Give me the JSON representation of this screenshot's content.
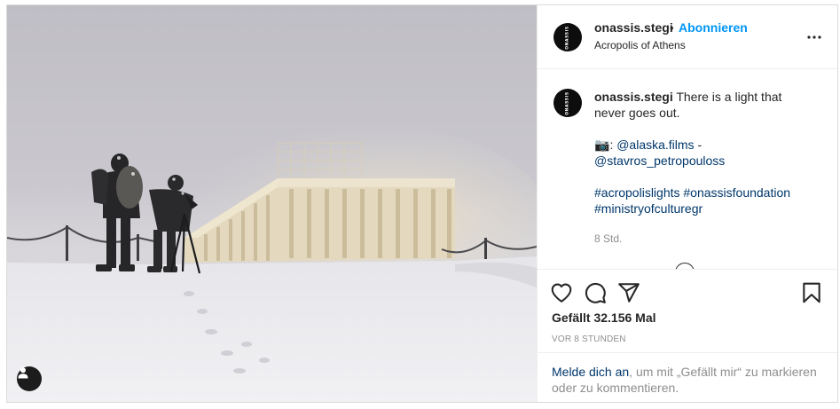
{
  "post": {
    "username": "onassis.stegi",
    "avatar_text": "ONASSIS",
    "dot": "•",
    "follow_label": "Abonnieren",
    "location": "Acropolis of Athens",
    "more_icon": "more-horizontal-icon"
  },
  "caption": {
    "username": "onassis.stegi",
    "text": "There is a light that never goes out.",
    "camera_emoji": "📷",
    "credit_sep": ":",
    "credit_1": "@alaska.films",
    "credit_dash": " -",
    "credit_2": "@stavros_petropouloss",
    "hashtag_1": "#acropolislights",
    "hashtag_2": "#onassisfoundation",
    "hashtag_3": "#ministryofculturegr",
    "time": "8 Std."
  },
  "actions": {
    "like_icon": "heart-icon",
    "comment_icon": "comment-icon",
    "share_icon": "paper-plane-icon",
    "save_icon": "bookmark-icon"
  },
  "likes": "Gefällt 32.156 Mal",
  "time_ago": "VOR 8 STUNDEN",
  "login": {
    "link": "Melde dich an",
    "rest": ", um mit „Gefällt mir“ zu markieren oder zu kommentieren."
  },
  "photo": {
    "user_tag_icon": "user-tag-icon"
  }
}
